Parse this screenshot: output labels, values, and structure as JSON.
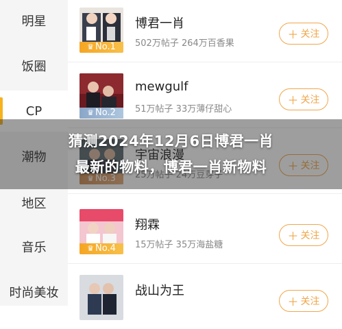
{
  "sidebar": {
    "items": [
      {
        "label": "明星"
      },
      {
        "label": "饭圈"
      },
      {
        "label": "CP"
      },
      {
        "label": "潮物"
      },
      {
        "label": "地区"
      },
      {
        "label": "音乐"
      },
      {
        "label": "时尚美妆"
      }
    ],
    "active_index": 2
  },
  "list": {
    "items": [
      {
        "name": "博君一肖",
        "stats": "502万帖子 264万百香果",
        "rank": "No.1",
        "rank_color": "#f5a623",
        "follow_label": "关注"
      },
      {
        "name": "mewgulf",
        "stats": "51万帖子 33万薄仔甜心",
        "rank": "No.2",
        "rank_color": "#8aa7c8",
        "follow_label": "关注"
      },
      {
        "name": "宇宙浪漫",
        "stats": "25万帖子 24万豆芽子",
        "rank": "No.3",
        "rank_color": "#c98a54",
        "follow_label": "关注"
      },
      {
        "name": "翔霖",
        "stats": "15万帖子 35万海盐糖",
        "rank": "No.4",
        "rank_color": "#f5a623",
        "follow_label": "关注"
      },
      {
        "name": "战山为王",
        "stats": "",
        "rank": "",
        "rank_color": "#f5a623",
        "follow_label": "关注"
      }
    ]
  },
  "overlay": {
    "line1": "猜测2024年12月6日博君一肖",
    "line2": "最新的物料，博君一肖新物料"
  },
  "colors": {
    "accent": "#f0a648",
    "sidebar_bg": "#f5f5f5"
  }
}
